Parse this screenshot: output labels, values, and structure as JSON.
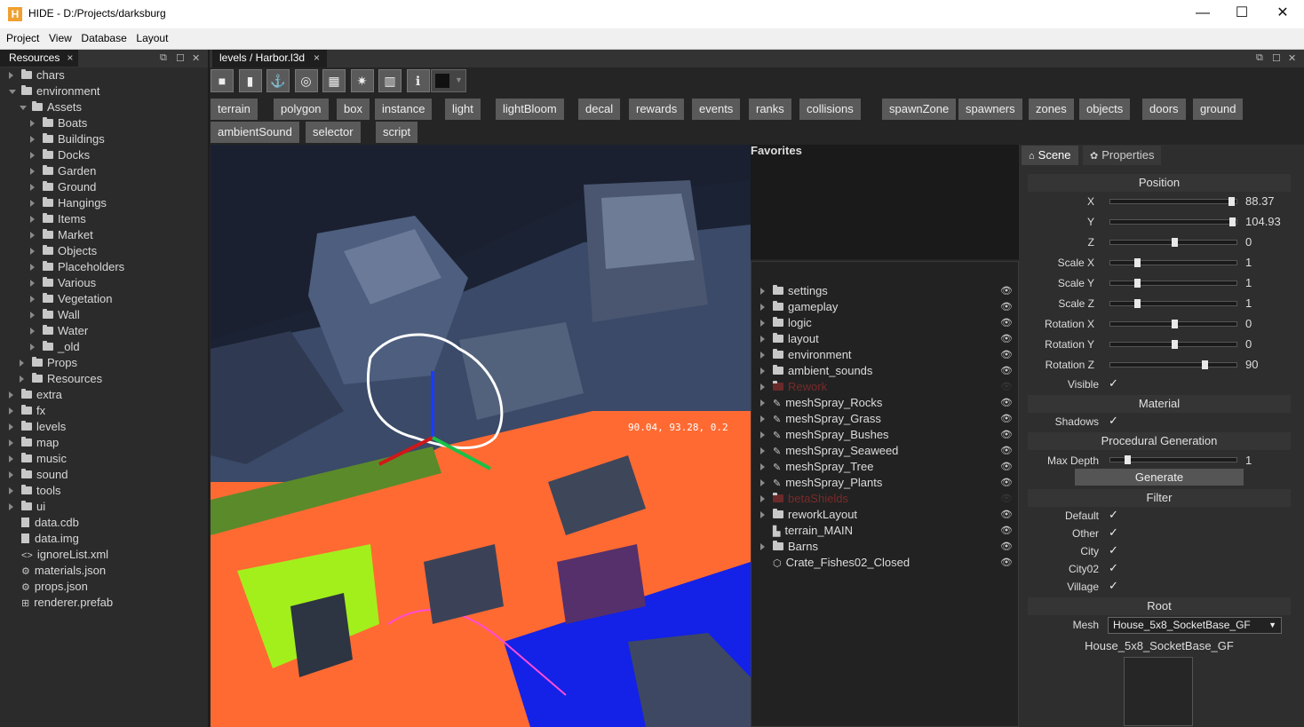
{
  "window": {
    "app_icon": "H",
    "title": "HIDE - D:/Projects/darksburg",
    "minimize": "—",
    "maximize": "☐",
    "close": "✕"
  },
  "menu": [
    "Project",
    "View",
    "Database",
    "Layout"
  ],
  "resources_tab": {
    "label": "Resources",
    "close": "×"
  },
  "resource_tree": [
    {
      "label": "chars",
      "type": "folder",
      "depth": 0,
      "open": false
    },
    {
      "label": "environment",
      "type": "folder",
      "depth": 0,
      "open": true
    },
    {
      "label": "Assets",
      "type": "folder",
      "depth": 1,
      "open": true
    },
    {
      "label": "Boats",
      "type": "folder",
      "depth": 2,
      "open": false
    },
    {
      "label": "Buildings",
      "type": "folder",
      "depth": 2,
      "open": false
    },
    {
      "label": "Docks",
      "type": "folder",
      "depth": 2,
      "open": false
    },
    {
      "label": "Garden",
      "type": "folder",
      "depth": 2,
      "open": false
    },
    {
      "label": "Ground",
      "type": "folder",
      "depth": 2,
      "open": false
    },
    {
      "label": "Hangings",
      "type": "folder",
      "depth": 2,
      "open": false
    },
    {
      "label": "Items",
      "type": "folder",
      "depth": 2,
      "open": false
    },
    {
      "label": "Market",
      "type": "folder",
      "depth": 2,
      "open": false
    },
    {
      "label": "Objects",
      "type": "folder",
      "depth": 2,
      "open": false
    },
    {
      "label": "Placeholders",
      "type": "folder",
      "depth": 2,
      "open": false
    },
    {
      "label": "Various",
      "type": "folder",
      "depth": 2,
      "open": false
    },
    {
      "label": "Vegetation",
      "type": "folder",
      "depth": 2,
      "open": false
    },
    {
      "label": "Wall",
      "type": "folder",
      "depth": 2,
      "open": false
    },
    {
      "label": "Water",
      "type": "folder",
      "depth": 2,
      "open": false
    },
    {
      "label": "_old",
      "type": "folder",
      "depth": 2,
      "open": false
    },
    {
      "label": "Props",
      "type": "folder",
      "depth": 1,
      "open": false
    },
    {
      "label": "Resources",
      "type": "folder",
      "depth": 1,
      "open": false
    },
    {
      "label": "extra",
      "type": "folder",
      "depth": 0,
      "open": false
    },
    {
      "label": "fx",
      "type": "folder",
      "depth": 0,
      "open": false
    },
    {
      "label": "levels",
      "type": "folder",
      "depth": 0,
      "open": false
    },
    {
      "label": "map",
      "type": "folder",
      "depth": 0,
      "open": false
    },
    {
      "label": "music",
      "type": "folder",
      "depth": 0,
      "open": false
    },
    {
      "label": "sound",
      "type": "folder",
      "depth": 0,
      "open": false
    },
    {
      "label": "tools",
      "type": "folder",
      "depth": 0,
      "open": false
    },
    {
      "label": "ui",
      "type": "folder",
      "depth": 0,
      "open": false
    },
    {
      "label": "data.cdb",
      "type": "file",
      "depth": 0
    },
    {
      "label": "data.img",
      "type": "file",
      "depth": 0
    },
    {
      "label": "ignoreList.xml",
      "type": "code",
      "depth": 0
    },
    {
      "label": "materials.json",
      "type": "json",
      "depth": 0
    },
    {
      "label": "props.json",
      "type": "json",
      "depth": 0
    },
    {
      "label": "renderer.prefab",
      "type": "prefab",
      "depth": 0
    }
  ],
  "level_tab": {
    "label": "levels / Harbor.l3d",
    "close": "×"
  },
  "toolbar_icons": [
    "camera-icon",
    "snapshot-icon",
    "anchor-icon",
    "target-icon",
    "grid-icon",
    "gear-icon",
    "map-icon",
    "info-icon"
  ],
  "toolbar_glyphs": [
    "■",
    "▮",
    "⚓",
    "◎",
    "▦",
    "✷",
    "▥",
    "ℹ"
  ],
  "categories_row1": [
    "terrain",
    "polygon",
    "box",
    "instance",
    "light",
    "lightBloom",
    "decal",
    "rewards",
    "events",
    "ranks",
    "collisions",
    "spawnZone",
    "spawners",
    "zones",
    "objects",
    "doors",
    "ground"
  ],
  "categories_row2": [
    "ambientSound",
    "selector",
    "script"
  ],
  "viewport": {
    "coord_readout": "90.04, 93.28, 0.2"
  },
  "favorites": {
    "title": "Favorites"
  },
  "outliner": [
    {
      "label": "settings",
      "type": "folder",
      "dim": false
    },
    {
      "label": "gameplay",
      "type": "folder",
      "dim": false
    },
    {
      "label": "logic",
      "type": "folder",
      "dim": false
    },
    {
      "label": "layout",
      "type": "folder",
      "dim": false
    },
    {
      "label": "environment",
      "type": "folder",
      "dim": false
    },
    {
      "label": "ambient_sounds",
      "type": "folder",
      "dim": false
    },
    {
      "label": "Rework",
      "type": "folder",
      "dim": true
    },
    {
      "label": "meshSpray_Rocks",
      "type": "brush",
      "dim": false
    },
    {
      "label": "meshSpray_Grass",
      "type": "brush",
      "dim": false
    },
    {
      "label": "meshSpray_Bushes",
      "type": "brush",
      "dim": false
    },
    {
      "label": "meshSpray_Seaweed",
      "type": "brush",
      "dim": false
    },
    {
      "label": "meshSpray_Tree",
      "type": "brush",
      "dim": false
    },
    {
      "label": "meshSpray_Plants",
      "type": "brush",
      "dim": false
    },
    {
      "label": "betaShields",
      "type": "folder",
      "dim": true
    },
    {
      "label": "reworkLayout",
      "type": "folder",
      "dim": false
    },
    {
      "label": "terrain_MAIN",
      "type": "terrain",
      "dim": false
    },
    {
      "label": "Barns",
      "type": "folder",
      "dim": false
    },
    {
      "label": "Crate_Fishes02_Closed",
      "type": "model",
      "dim": false
    }
  ],
  "props_tabs": {
    "scene": "Scene",
    "properties": "Properties"
  },
  "position": {
    "title": "Position",
    "fields": [
      {
        "label": "X",
        "value": "88.37",
        "fraction": 0.97
      },
      {
        "label": "Y",
        "value": "104.93",
        "fraction": 0.98
      },
      {
        "label": "Z",
        "value": "0",
        "fraction": 0.5
      },
      {
        "label": "Scale X",
        "value": "1",
        "fraction": 0.2
      },
      {
        "label": "Scale Y",
        "value": "1",
        "fraction": 0.2
      },
      {
        "label": "Scale Z",
        "value": "1",
        "fraction": 0.2
      },
      {
        "label": "Rotation X",
        "value": "0",
        "fraction": 0.5
      },
      {
        "label": "Rotation Y",
        "value": "0",
        "fraction": 0.5
      },
      {
        "label": "Rotation Z",
        "value": "90",
        "fraction": 0.75
      }
    ],
    "visible_label": "Visible"
  },
  "material": {
    "title": "Material",
    "shadows_label": "Shadows"
  },
  "procgen": {
    "title": "Procedural Generation",
    "max_depth_label": "Max Depth",
    "max_depth_value": "1",
    "max_depth_fraction": 0.12,
    "generate_label": "Generate"
  },
  "filter": {
    "title": "Filter",
    "items": [
      "Default",
      "Other",
      "City",
      "City02",
      "Village"
    ]
  },
  "root": {
    "title": "Root",
    "mesh_label": "Mesh",
    "mesh_value": "House_5x8_SocketBase_GF",
    "preview_caption": "House_5x8_SocketBase_GF"
  },
  "check_glyph": "✓"
}
